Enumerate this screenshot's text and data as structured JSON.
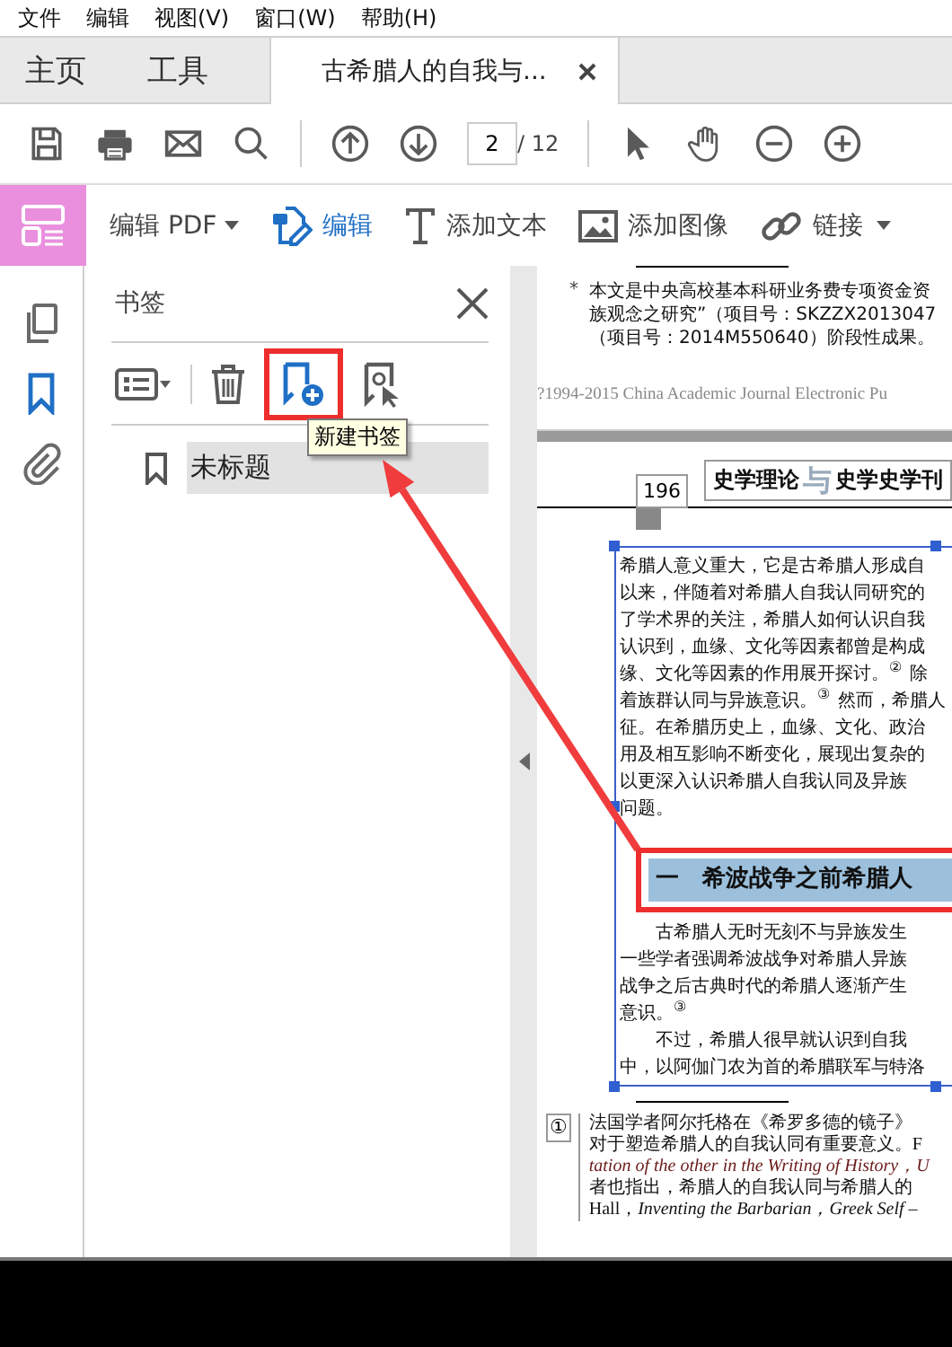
{
  "menu": [
    {
      "label": "文件"
    },
    {
      "label": "编辑"
    },
    {
      "label": "视图(V)"
    },
    {
      "label": "窗口(W)"
    },
    {
      "label": "帮助(H)"
    }
  ],
  "tabs": [
    {
      "label": "主页",
      "kind": "nav",
      "selected": false
    },
    {
      "label": "工具",
      "kind": "nav",
      "selected": false
    },
    {
      "label": "古希腊人的自我与...",
      "kind": "document",
      "selected": true
    }
  ],
  "toolbar": {
    "page_field": {
      "value": "2"
    },
    "page_total": "/ 12"
  },
  "edit_toolbar": {
    "title": "编辑 PDF",
    "tools": [
      {
        "label": "编辑",
        "kind": "edit",
        "selected": true
      },
      {
        "label": "添加文本",
        "kind": "text",
        "selected": false
      },
      {
        "label": "添加图像",
        "kind": "image",
        "selected": false
      },
      {
        "label": "链接",
        "kind": "link",
        "selected": false
      }
    ]
  },
  "side_rail": [
    {
      "kind": "pages",
      "selected": false
    },
    {
      "kind": "bookmarks",
      "selected": true
    },
    {
      "kind": "attachments",
      "selected": false
    }
  ],
  "bookmark_panel": {
    "title": "书签",
    "tooltip": "新建书签",
    "bookmarks": [
      {
        "label": "未标题",
        "selected": true
      }
    ]
  },
  "document": {
    "prev_footnote": {
      "marker": "*",
      "lines": [
        "本文是中央高校基本科研业务费专项资金资",
        "族观念之研究”（项目号：SKZZX2013047",
        "（项目号：2014M550640）阶段性成果。"
      ]
    },
    "copyright": "?1994-2015 China Academic Journal Electronic Pu",
    "page_number": "196",
    "journal": {
      "left": "史学理论",
      "mark": "与",
      "right": "史学史学刊"
    },
    "paragraphs_top": [
      {
        "continued": true,
        "lines": [
          "希腊人意义重大，它是古希腊人形成自",
          "以来，伴随着对希腊人自我认同研究的",
          "了学术界的关注，希腊人如何认识自我",
          "认识到，血缘、文化等因素都曾是构成",
          "缘、文化等因素的作用展开探讨。$^{②}$ 除",
          "着族群认同与异族意识。$^{③}$ 然而，希腊人",
          "征。在希腊历史上，血缘、文化、政治",
          "用及相互影响不断变化，展现出复杂的",
          "以更深入认识希腊人自我认同及异族",
          "问题。"
        ]
      }
    ],
    "heading": "一　希波战争之前希腊人",
    "paragraphs_bottom": [
      {
        "continued": false,
        "lines": [
          "古希腊人无时无刻不与异族发生",
          "一些学者强调希波战争对希腊人异族",
          "战争之后古典时代的希腊人逐渐产生",
          "意识。$^{③}$"
        ]
      },
      {
        "continued": false,
        "lines": [
          "不过，希腊人很早就认识到自我",
          "中，以阿伽门农为首的希腊联军与特洛"
        ]
      }
    ],
    "footnote": {
      "marker": "①",
      "lines": [
        {
          "text": "法国学者阿尔托格在《希罗多德的镜子》",
          "italic": false
        },
        {
          "text": "对于塑造希腊人的自我认同有重要意义。F",
          "italic": false
        },
        {
          "text": "tation of the other in the Writing of History，U",
          "italic": true
        },
        {
          "text": "者也指出，希腊人的自我认同与希腊人的",
          "italic": false
        },
        {
          "text": "Hall，*Inventing the Barbarian，Greek Self –*",
          "italic": false
        }
      ]
    }
  }
}
